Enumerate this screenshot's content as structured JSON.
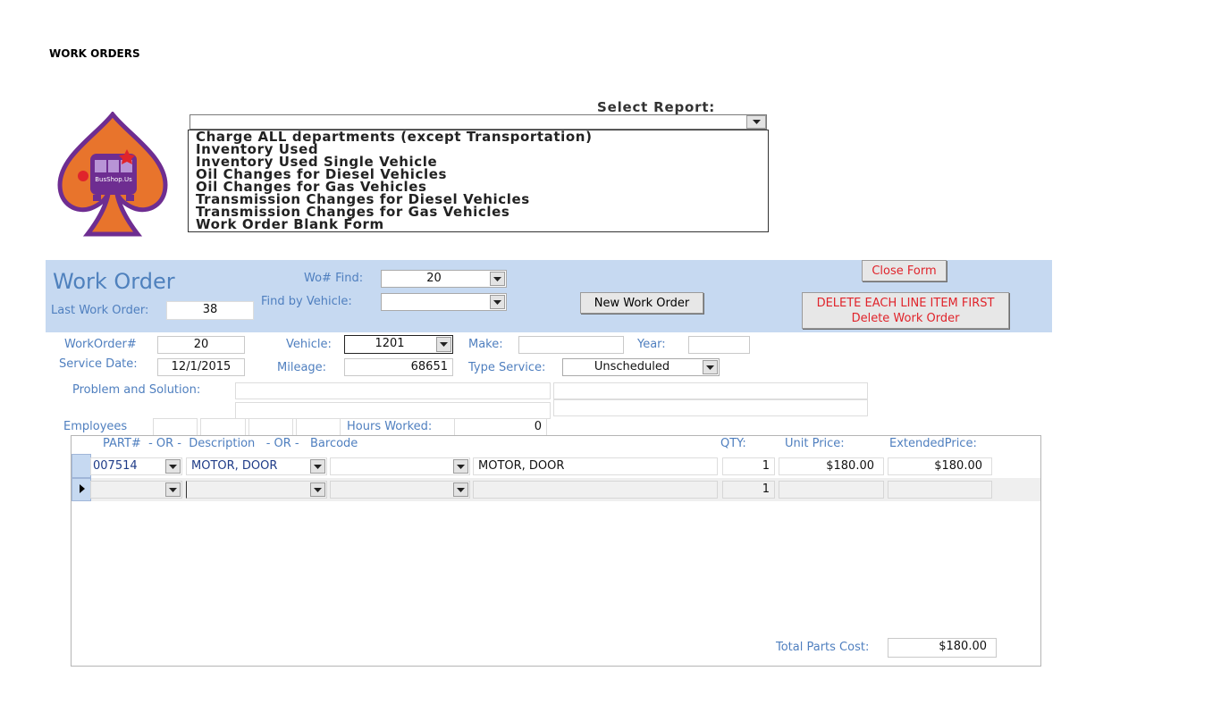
{
  "page_title": "WORK ORDERS",
  "report": {
    "label": "Select Report:",
    "selected_value": "",
    "options": [
      "Charge ALL departments (except Transportation)",
      "Inventory Used",
      "Inventory Used Single Vehicle",
      "Oil Changes for Diesel Vehicles",
      "Oil Changes for Gas Vehicles",
      "Transmission Changes for Diesel Vehicles",
      "Transmission Changes for Gas Vehicles",
      "Work Order Blank Form"
    ]
  },
  "logo": {
    "text": "BusShop.Us",
    "colors": {
      "orange": "#e8742c",
      "purple": "#6e2d91"
    }
  },
  "header": {
    "title": "Work Order",
    "wo_find_label": "Wo# Find:",
    "wo_find_value": "20",
    "find_vehicle_label": "Find by Vehicle:",
    "find_vehicle_value": "",
    "last_wo_label": "Last Work Order:",
    "last_wo_value": "38",
    "new_wo_button": "New Work Order",
    "close_button": "Close Form",
    "delete_line1": "DELETE EACH LINE ITEM FIRST",
    "delete_line2": "Delete Work Order",
    "band_color": "#c6d9f1",
    "danger_color": "#e0242b"
  },
  "form": {
    "workorder_label": "WorkOrder#",
    "workorder_value": "20",
    "vehicle_label": "Vehicle:",
    "vehicle_value": "1201",
    "make_label": "Make:",
    "make_value": "",
    "year_label": "Year:",
    "year_value": "",
    "service_date_label": "Service Date:",
    "service_date_value": "12/1/2015",
    "mileage_label": "Mileage:",
    "mileage_value": "68651",
    "type_service_label": "Type Service:",
    "type_service_value": "Unscheduled",
    "problem_label": "Problem and Solution:",
    "employees_label": "Employees",
    "hours_label": "Hours Worked:",
    "hours_value": "0"
  },
  "parts": {
    "col_part": "PART#  - OR -  Description   - OR -   Barcode",
    "col_qty": "QTY:",
    "col_unit": "Unit Price:",
    "col_ext": "ExtendedPrice:",
    "rows": [
      {
        "part": "007514",
        "description": "MOTOR, DOOR",
        "barcode": "",
        "desc_text": "MOTOR, DOOR",
        "qty": "1",
        "unit": "$180.00",
        "ext": "$180.00"
      },
      {
        "part": "",
        "description": "",
        "barcode": "",
        "desc_text": "",
        "qty": "1",
        "unit": "",
        "ext": ""
      }
    ],
    "total_label": "Total Parts Cost:",
    "total_value": "$180.00"
  }
}
